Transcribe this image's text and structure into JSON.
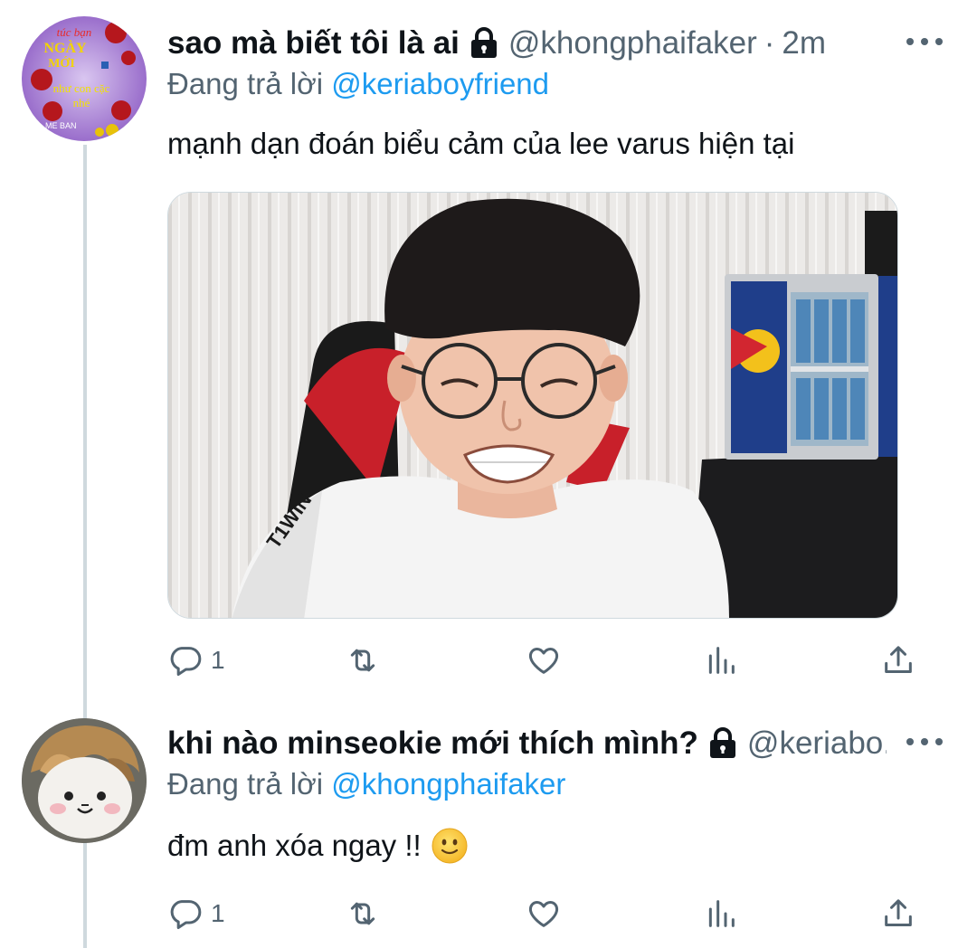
{
  "tweets": [
    {
      "display_name": "sao mà biết tôi là ai",
      "handle": "@khongphaifaker",
      "separator": "·",
      "time": "2m",
      "replying_prefix": "Đang trả lời ",
      "replying_to": "@keriaboyfriend",
      "text": "mạnh dạn đoán biểu cảm của lee varus hiện tại",
      "reply_count": "1",
      "avatar_text": {
        "l1": "túc bạn",
        "l2": "NGÀY",
        "l3": "MỚI",
        "l4": "như con cặc",
        "l5": "nhé",
        "l6": "ME BAN"
      },
      "media_text": "T1WIN"
    },
    {
      "display_name": "khi nào minseokie mới thích mình?",
      "handle": "@keriabo...",
      "replying_prefix": "Đang trả lời ",
      "replying_to": "@khongphaifaker",
      "text": "đm anh xóa ngay !!",
      "reply_count": "1",
      "emoji": "slightly-smiling-face"
    }
  ],
  "icons": {
    "reply": "speech-bubble-icon",
    "retweet": "retweet-icon",
    "like": "heart-icon",
    "views": "bar-chart-icon",
    "share": "share-upload-icon",
    "more": "more-dots-icon",
    "lock": "lock-icon"
  },
  "colors": {
    "text": "#0f1419",
    "secondary": "#536471",
    "link": "#1d9bf0",
    "thread_line": "#cfd9de"
  }
}
